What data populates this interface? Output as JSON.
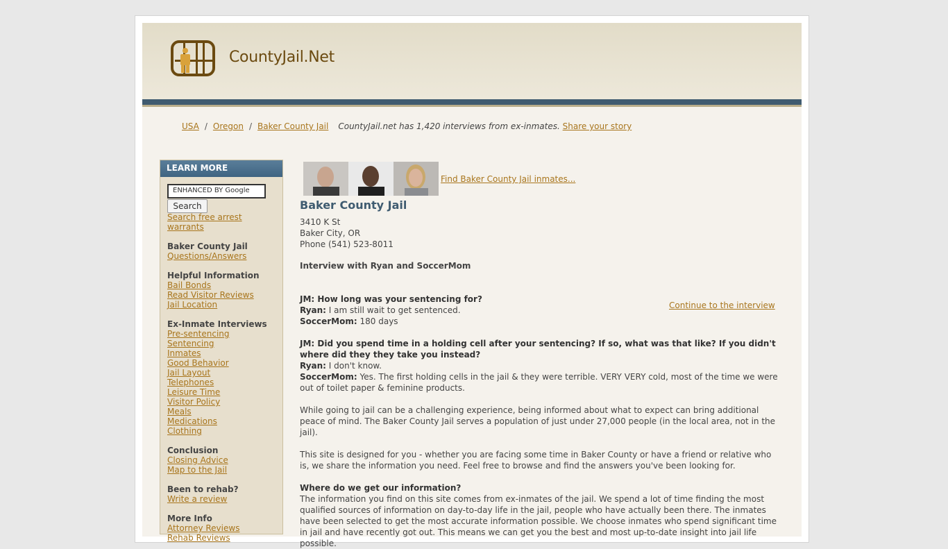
{
  "site": {
    "name": "CountyJail.Net"
  },
  "breadcrumb": {
    "items": [
      "USA",
      "Oregon",
      "Baker County Jail"
    ],
    "note": "CountyJail.net has 1,420 interviews from ex-inmates.",
    "share_link": "Share your story"
  },
  "sidebar": {
    "heading": "LEARN MORE",
    "search_placeholder": "ENHANCED BY Google",
    "search_button": "Search",
    "warrants_link": "Search free arrest warrants",
    "sections": [
      {
        "title": "Baker County Jail",
        "links": [
          "Questions/Answers"
        ]
      },
      {
        "title": "Helpful Information",
        "links": [
          "Bail Bonds",
          "Read Visitor Reviews",
          "Jail Location"
        ]
      },
      {
        "title": "Ex-Inmate Interviews",
        "links": [
          "Pre-sentencing",
          "Sentencing",
          "Inmates",
          "Good Behavior",
          "Jail Layout",
          "Telephones",
          "Leisure Time",
          "Visitor Policy",
          "Meals",
          "Medications",
          "Clothing"
        ]
      },
      {
        "title": "Conclusion",
        "links": [
          "Closing Advice",
          "Map to the Jail"
        ]
      },
      {
        "title": "Been to rehab?",
        "links": [
          "Write a review"
        ]
      },
      {
        "title": "More Info",
        "links": [
          "Attorney Reviews",
          "Rehab Reviews"
        ]
      }
    ]
  },
  "main": {
    "find_link": "Find Baker County Jail inmates...",
    "title": "Baker County Jail",
    "address": [
      "3410 K St",
      "Baker City, OR",
      "Phone (541) 523-8011"
    ],
    "interview_title": "Interview with Ryan and SoccerMom",
    "continue_link": "Continue to the interview",
    "q1": {
      "question": "JM: How long was your sentencing for?",
      "a1_name": "Ryan:",
      "a1_text": "I am still wait to get sentenced.",
      "a2_name": "SoccerMom:",
      "a2_text": "180 days"
    },
    "q2": {
      "question": "JM: Did you spend time in a holding cell after your sentencing? If so, what was that like? If you didn't where did they they take you instead?",
      "a1_name": "Ryan:",
      "a1_text": "I don't know.",
      "a2_name": "SoccerMom:",
      "a2_text": "Yes. The first holding cells in the jail & they were terrible. VERY VERY cold, most of the time we were out of toilet paper & feminine products."
    },
    "para1": "While going to jail can be a challenging experience, being informed about what to expect can bring additional peace of mind. The Baker County Jail serves a population of just under 27,000 people (in the local area, not in the jail).",
    "para2": "This site is designed for you - whether you are facing some time in Baker County or have a friend or relative who is, we share the information you need. Feel free to browse and find the answers you've been looking for.",
    "info_heading": "Where do we get our information?",
    "info_text": "The information you find on this site comes from ex-inmates of the jail. We spend a lot of time finding the most qualified sources of information on day-to-day life in the jail, people who have actually been there. The inmates have been selected to get the most accurate information possible. We choose inmates who spend significant time in jail and have recently got out. This means we can get you the best and most up-to-date insight into jail life possible."
  }
}
